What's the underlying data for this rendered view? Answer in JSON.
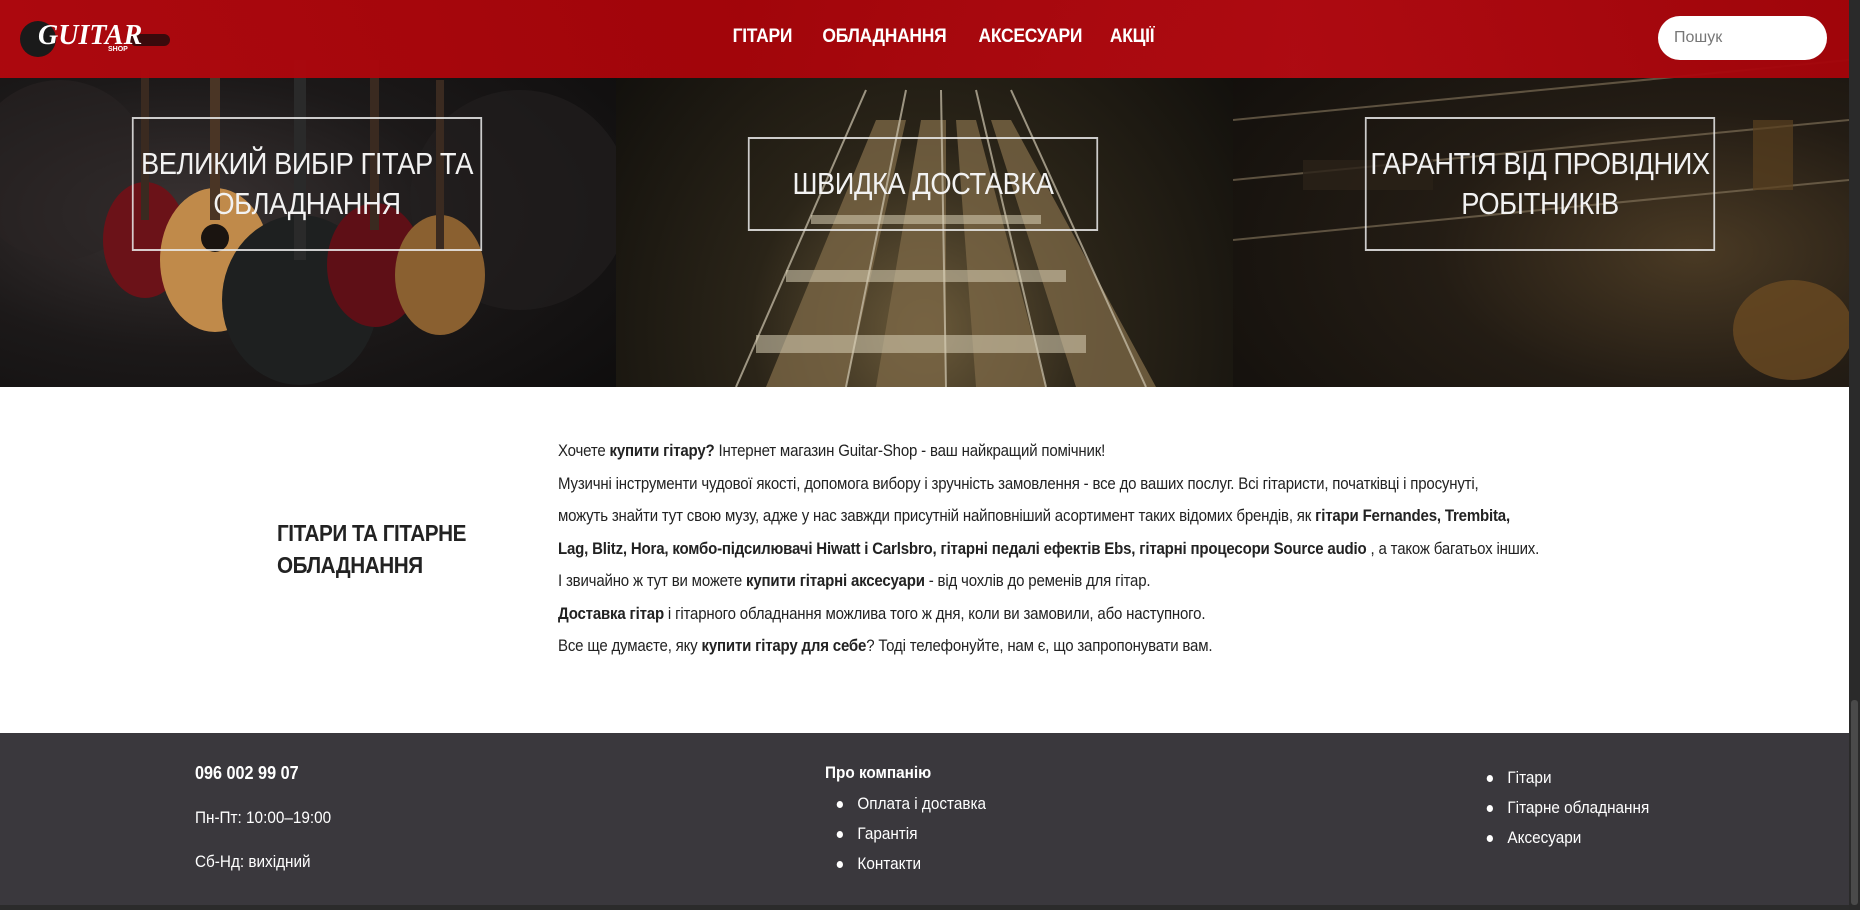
{
  "header": {
    "logo_text": "GUITAR",
    "logo_sub": "SHOP",
    "nav": [
      "ГІТАРИ",
      "ОБЛАДНАННЯ",
      "АКСЕСУАРИ",
      "АКЦІЇ"
    ],
    "search_placeholder": "Пошук"
  },
  "hero": {
    "panels": [
      {
        "title": "ВЕЛИКИЙ ВИБІР ГІТАР ТА ОБЛАДНАННЯ",
        "image": "guitars-photo"
      },
      {
        "title": "ШВИДКА ДОСТАВКА",
        "image": "fretboard-photo"
      },
      {
        "title": "ГАРАНТІЯ ВІД ПРОВІДНИХ РОБІТНИКІВ",
        "image": "guitar-bridge-photo"
      }
    ]
  },
  "about": {
    "title": "ГІТАРИ ТА ГІТАРНЕ ОБЛАДНАННЯ",
    "lines": [
      [
        {
          "t": "Хочете "
        },
        {
          "t": "купити гітару?",
          "b": true
        },
        {
          "t": " Інтернет магазин Guitar-Shop - ваш найкращий помічник!"
        }
      ],
      [
        {
          "t": "Музичні інструменти чудової якості, допомога вибору і зручність замовлення - все до ваших послуг. Всі гітаристи, початківці і просунуті,"
        }
      ],
      [
        {
          "t": "можуть знайти тут свою музу, адже у нас завжди присутній найповніший асортимент таких відомих брендів, як "
        },
        {
          "t": "гітари Fernandes, Trembita,",
          "b": true
        }
      ],
      [
        {
          "t": "Lag, Blitz, Hora, комбо-підсилювачі Hiwatt і Carlsbro, гітарні педалі ефектів Ebs, гітарні процесори Source audio",
          "b": true
        },
        {
          "t": " , а також багатьох інших."
        }
      ],
      [
        {
          "t": "І звичайно ж тут ви можете "
        },
        {
          "t": "купити гітарні аксесуари",
          "b": true
        },
        {
          "t": " - від чохлів до ременів для гітар."
        }
      ],
      [
        {
          "t": "Доставка гітар",
          "b": true
        },
        {
          "t": " і гітарного обладнання можлива того ж дня, коли ви замовили, або наступного."
        }
      ],
      [
        {
          "t": "Все ще думаєте, яку "
        },
        {
          "t": "купити гітару для себе",
          "b": true
        },
        {
          "t": "? Тоді телефонуйте, нам є, що запропонувати вам."
        }
      ]
    ]
  },
  "footer": {
    "phone": "096 002 99 07",
    "hours": "Пн-Пт: 10:00–19:00",
    "weekend": "Сб-Нд: вихідний",
    "company_title": "Про компанію",
    "company_links": [
      "Оплата і доставка",
      "Гарантія",
      "Контакти"
    ],
    "category_links": [
      "Гітари",
      "Гітарне обладнання",
      "Аксесуари"
    ]
  },
  "colors": {
    "header_red": "#b0080e",
    "footer_bg": "#3a383d",
    "about_bg": "#ffffff",
    "text_dark": "#222222"
  }
}
